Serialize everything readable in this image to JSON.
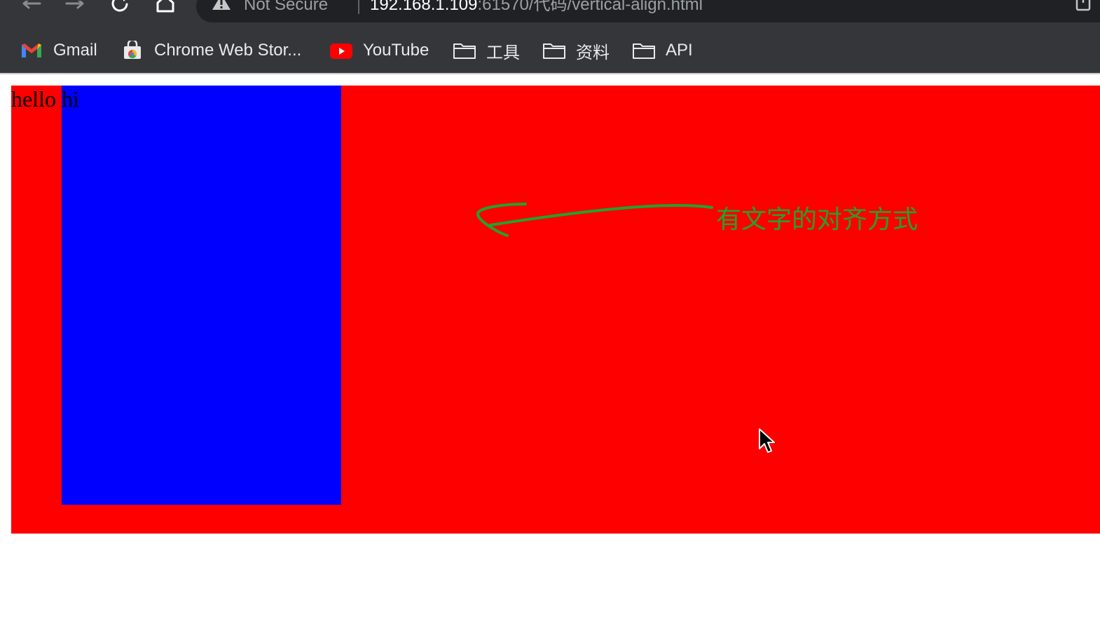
{
  "browser": {
    "nav": {
      "back_icon": "arrow-left-icon",
      "forward_icon": "arrow-right-icon",
      "reload_icon": "reload-icon",
      "home_icon": "home-icon"
    },
    "omnibox": {
      "security_label": "Not Secure",
      "url_host": "192.168.1.109",
      "url_path": ":61570/代码/vertical-align.html"
    },
    "bookmarks": [
      {
        "label": "Gmail",
        "icon": "gmail-icon"
      },
      {
        "label": "Chrome Web Stor...",
        "icon": "chrome-web-store-icon"
      },
      {
        "label": "YouTube",
        "icon": "youtube-icon"
      },
      {
        "label": "工具",
        "icon": "folder-icon"
      },
      {
        "label": "资料",
        "icon": "folder-icon"
      },
      {
        "label": "API",
        "icon": "folder-icon"
      }
    ]
  },
  "page": {
    "text": "hello hi",
    "colors": {
      "outer_box": "#ff0000",
      "inner_box": "#0000ff"
    },
    "annotation": {
      "text": "有文字的对齐方式",
      "color": "#1fa32f"
    }
  }
}
